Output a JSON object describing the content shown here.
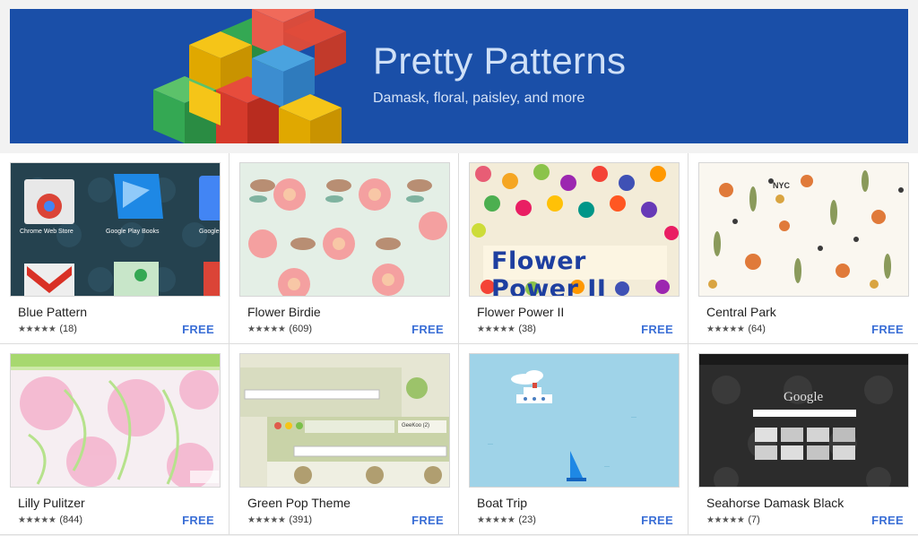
{
  "banner": {
    "title": "Pretty Patterns",
    "subtitle": "Damask, floral, paisley, and more",
    "background_color": "#1a4fa8"
  },
  "themes": [
    {
      "name": "Blue Pattern",
      "rating_count": "(18)",
      "stars": 5,
      "price": "FREE",
      "thumb_labels": [
        "Chrome Web Store",
        "Google Play Books",
        "Google"
      ]
    },
    {
      "name": "Flower Birdie",
      "rating_count": "(609)",
      "stars": 5,
      "price": "FREE"
    },
    {
      "name": "Flower Power II",
      "rating_count": "(38)",
      "stars": 4.5,
      "price": "FREE",
      "thumb_labels": [
        "Flower Power II"
      ]
    },
    {
      "name": "Central Park",
      "rating_count": "(64)",
      "stars": 4.5,
      "price": "FREE",
      "thumb_labels": [
        "NYC"
      ]
    },
    {
      "name": "Lilly Pulitzer",
      "rating_count": "(844)",
      "stars": 4.5,
      "price": "FREE"
    },
    {
      "name": "Green Pop Theme",
      "rating_count": "(391)",
      "stars": 5,
      "price": "FREE",
      "thumb_labels": [
        "GeeKoo (2)"
      ]
    },
    {
      "name": "Boat Trip",
      "rating_count": "(23)",
      "stars": 4.5,
      "price": "FREE"
    },
    {
      "name": "Seahorse Damask Black",
      "rating_count": "(7)",
      "stars": 5,
      "price": "FREE",
      "thumb_labels": [
        "Google"
      ]
    }
  ],
  "stars_glyph": "★★★★★",
  "accent_color": "#3b6fd6"
}
